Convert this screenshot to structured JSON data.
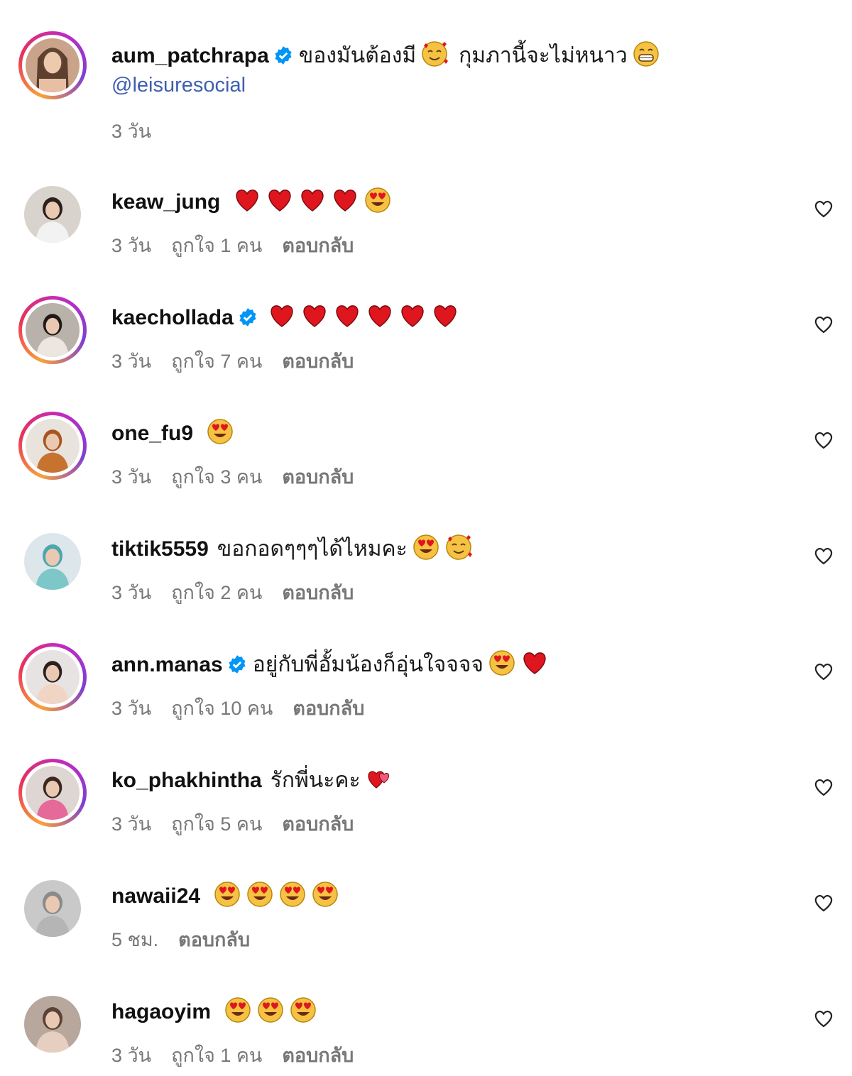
{
  "caption": {
    "username": "aum_patchrapa",
    "verified": true,
    "text_a": "ของมันต้องมี",
    "text_b": "กุมภานี้จะไม่หนาว",
    "mention": "@leisuresocial",
    "time": "3 วัน"
  },
  "reply_label": "ตอบกลับ",
  "comments": [
    {
      "username": "keaw_jung",
      "verified": false,
      "text": "",
      "time": "3 วัน",
      "likes": "ถูกใจ 1 คน",
      "emojis": [
        "heart",
        "heart",
        "heart",
        "heart",
        "heart-eyes"
      ]
    },
    {
      "username": "kaechollada",
      "verified": true,
      "text": "",
      "time": "3 วัน",
      "likes": "ถูกใจ 7 คน",
      "emojis": [
        "heart",
        "heart",
        "heart",
        "heart",
        "heart",
        "heart"
      ]
    },
    {
      "username": "one_fu9",
      "verified": false,
      "text": "",
      "time": "3 วัน",
      "likes": "ถูกใจ 3 คน",
      "emojis": [
        "heart-eyes"
      ]
    },
    {
      "username": "tiktik5559",
      "verified": false,
      "text": "ขอกอดๆๆๆได้ไหมคะ",
      "time": "3 วัน",
      "likes": "ถูกใจ 2 คน",
      "emojis": [
        "heart-eyes",
        "smiling-hearts"
      ]
    },
    {
      "username": "ann.manas",
      "verified": true,
      "text": "อยู่กับพี่อั้มน้องก็อุ่นใจจจจ",
      "time": "3 วัน",
      "likes": "ถูกใจ 10 คน",
      "emojis": [
        "heart-eyes",
        "heart"
      ]
    },
    {
      "username": "ko_phakhintha",
      "verified": false,
      "text": "รักพี่นะคะ",
      "time": "3 วัน",
      "likes": "ถูกใจ 5 คน",
      "emojis": [
        "two-hearts"
      ]
    },
    {
      "username": "nawaii24",
      "verified": false,
      "text": "",
      "time": "5 ชม.",
      "likes": "",
      "emojis": [
        "heart-eyes",
        "heart-eyes",
        "heart-eyes",
        "heart-eyes"
      ]
    },
    {
      "username": "hagaoyim",
      "verified": false,
      "text": "",
      "time": "3 วัน",
      "likes": "ถูกใจ 1 คน",
      "emojis": [
        "heart-eyes",
        "heart-eyes",
        "heart-eyes"
      ]
    }
  ],
  "colors": {
    "mention": "#3e5fb0",
    "verified": "#0095f6",
    "meta": "#777777",
    "heart": "#e0161e"
  }
}
